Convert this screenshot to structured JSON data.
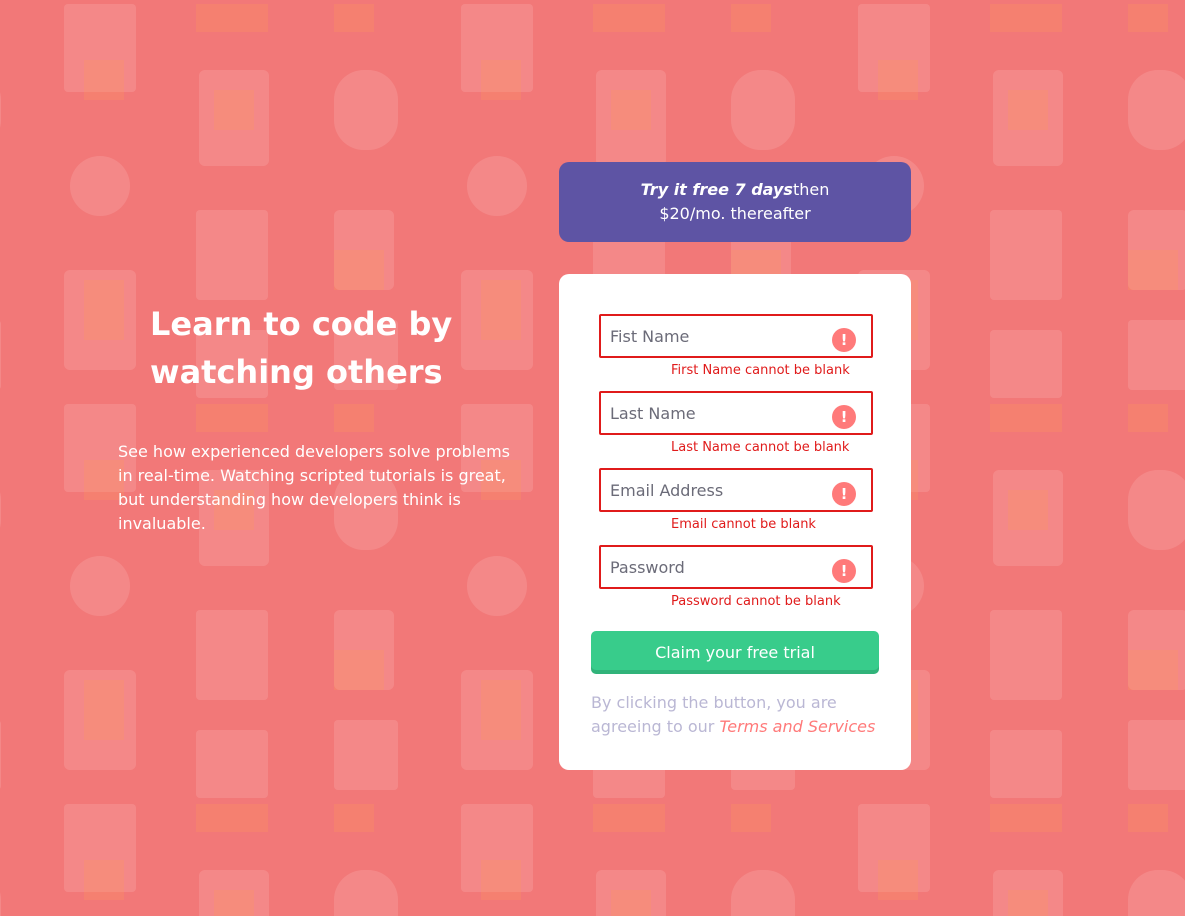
{
  "theme": {
    "background": "#f27878",
    "promo_bg": "#5e54a4",
    "button_bg": "#38cc8b",
    "error": "#e01b1b",
    "link": "#ff7a7a",
    "muted": "#bab7d4"
  },
  "hero": {
    "title": "Learn to code by watching others",
    "description": "See how experienced developers solve problems in real-time. Watching scripted tutorials is great, but understanding how developers think is invaluable."
  },
  "promo": {
    "strong": "Try it free 7 days",
    "rest": "then",
    "line2": "$20/mo. thereafter"
  },
  "form": {
    "fields": [
      {
        "placeholder": "Fist Name",
        "error": "First Name cannot be blank",
        "icon": "error-exclamation-icon"
      },
      {
        "placeholder": "Last Name",
        "error": "Last Name cannot be blank",
        "icon": "error-exclamation-icon"
      },
      {
        "placeholder": "Email Address",
        "error": "Email cannot be blank",
        "icon": "error-exclamation-icon"
      },
      {
        "placeholder": "Password",
        "error": "Password cannot be blank",
        "icon": "error-exclamation-icon"
      }
    ],
    "error_icon_glyph": "!",
    "submit_label": "Claim your free trial",
    "terms_prefix": "By clicking the button, you are agreeing to our",
    "terms_link": "Terms and Services"
  }
}
